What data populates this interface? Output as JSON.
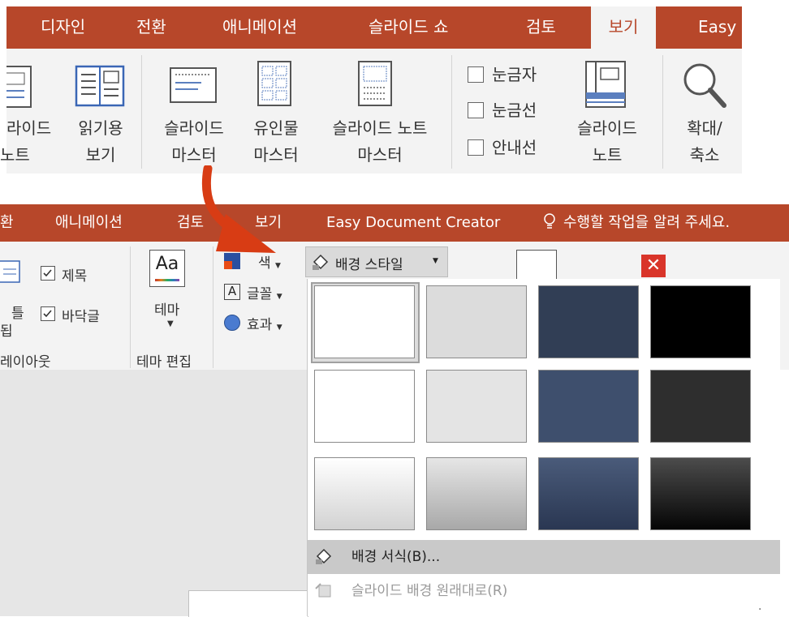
{
  "top": {
    "tabs": [
      "디자인",
      "전환",
      "애니메이션",
      "슬라이드 쇼",
      "검토",
      "보기",
      "Easy"
    ],
    "active_tab": "보기",
    "buttons": {
      "slide_note": [
        "라이드",
        "노트"
      ],
      "reading": [
        "읽기용",
        "보기"
      ],
      "slide_master": [
        "슬라이드",
        "마스터"
      ],
      "handout_master": [
        "유인물",
        "마스터"
      ],
      "notes_master": [
        "슬라이드 노트",
        "마스터"
      ],
      "notes": [
        "슬라이드",
        "노트"
      ],
      "zoom": [
        "확대/",
        "축소"
      ]
    },
    "checkboxes": [
      "눈금자",
      "눈금선",
      "안내선"
    ]
  },
  "bottom": {
    "tabs": [
      "환",
      "애니메이션",
      "검토",
      "보기",
      "Easy Document Creator"
    ],
    "tell_me": "수행할 작업을 알려 주세요.",
    "checkboxes": [
      "제목",
      "바닥글"
    ],
    "layout_partial": [
      "틀",
      "됩"
    ],
    "layout_group": "레이아웃",
    "theme_button": "테마",
    "theme_group": "테마 편집",
    "colors_label": "색",
    "fonts_label": "글꼴",
    "effects_label": "효과",
    "bg_styles_label": "배경 스타일"
  },
  "gallery": {
    "swatches": [
      {
        "fill": "#ffffff",
        "selected": true
      },
      {
        "fill": "#dcdcdc"
      },
      {
        "fill": "#313e55"
      },
      {
        "fill": "#000000"
      },
      {
        "fill": "#ffffff"
      },
      {
        "fill": "#e4e4e4"
      },
      {
        "fill": "#3e4f6d"
      },
      {
        "fill": "#2e2e2e"
      },
      {
        "fill": "linear-gradient(#ffffff,#d2d2d2)"
      },
      {
        "fill": "linear-gradient(#e6e6e6,#a8a8a8)"
      },
      {
        "fill": "linear-gradient(#4a5b7a,#2a3752)"
      },
      {
        "fill": "linear-gradient(#4c4c4c,#050505)"
      }
    ],
    "menu": [
      {
        "label": "배경 서식(B)...",
        "highlighted": true,
        "enabled": true
      },
      {
        "label": "슬라이드 배경 원래대로(R)",
        "highlighted": false,
        "enabled": false
      }
    ]
  },
  "colors": {
    "accent": "#b7472a",
    "arrow": "#d83c14"
  }
}
